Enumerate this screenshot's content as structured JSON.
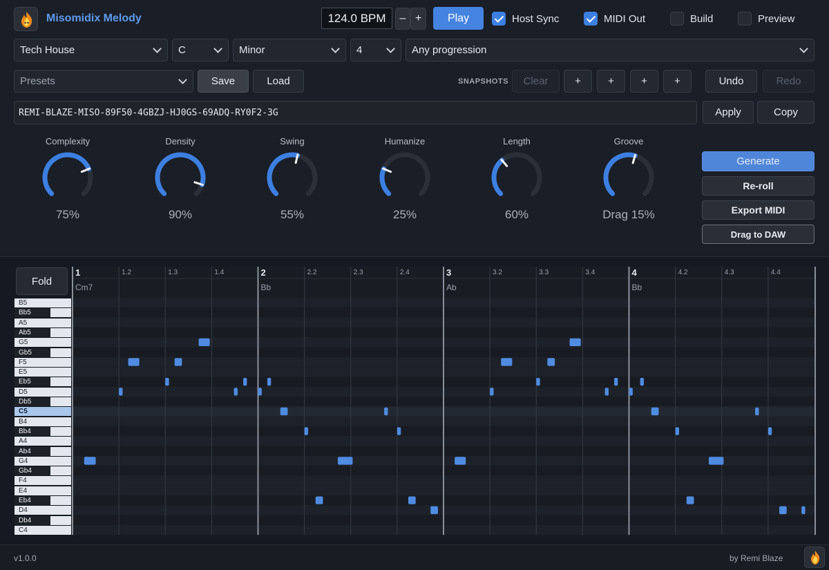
{
  "app": {
    "title": "Misomidix Melody",
    "version": "v1.0.0",
    "author": "by Remi Blaze"
  },
  "transport": {
    "bpm": "124.0 BPM",
    "minus": "–",
    "plus": "+",
    "play": "Play"
  },
  "toggles": [
    {
      "label": "Host Sync",
      "checked": true
    },
    {
      "label": "MIDI Out",
      "checked": true
    },
    {
      "label": "Build",
      "checked": false
    },
    {
      "label": "Preview",
      "checked": false
    }
  ],
  "selectors": {
    "style": "Tech House",
    "key": "C",
    "scale": "Minor",
    "bars": "4",
    "progression": "Any progression"
  },
  "presets": {
    "placeholder": "Presets",
    "save": "Save",
    "load": "Load"
  },
  "snapshots": {
    "label": "SNAPSHOTS",
    "clear": "Clear",
    "slots": [
      "+",
      "+",
      "+",
      "+"
    ]
  },
  "history": {
    "undo": "Undo",
    "redo": "Redo"
  },
  "seed": {
    "value": "REMI-BLAZE-MISO-89F50-4GBZJ-HJ0GS-69ADQ-RY0F2-3G",
    "apply": "Apply",
    "copy": "Copy"
  },
  "knobs": [
    {
      "label": "Complexity",
      "value": "75%",
      "level": 0.75
    },
    {
      "label": "Density",
      "value": "90%",
      "level": 0.9
    },
    {
      "label": "Swing",
      "value": "55%",
      "level": 0.55
    },
    {
      "label": "Humanize",
      "value": "25%",
      "level": 0.25
    },
    {
      "label": "Length",
      "value": "60%",
      "level": 0.35
    },
    {
      "label": "Groove",
      "value": "Drag 15%",
      "level": 0.56
    }
  ],
  "actions": {
    "generate": "Generate",
    "reroll": "Re-roll",
    "export": "Export MIDI",
    "drag": "Drag to DAW"
  },
  "roll": {
    "fold": "Fold",
    "ruler": [
      "1",
      "1.2",
      "1.3",
      "1.4",
      "2",
      "2.2",
      "2.3",
      "2.4",
      "3",
      "3.2",
      "3.3",
      "3.4",
      "4",
      "4.2",
      "4.3",
      "4.4"
    ],
    "chords": [
      "Cm7",
      "Bb",
      "Ab",
      "Bb"
    ],
    "keys": [
      "B5",
      "Bb5",
      "A5",
      "Ab5",
      "G5",
      "Gb5",
      "F5",
      "E5",
      "Eb5",
      "D5",
      "Db5",
      "C5",
      "B4",
      "Bb4",
      "A4",
      "Ab4",
      "G4",
      "Gb4",
      "F4",
      "E4",
      "Eb4",
      "D4",
      "Db4",
      "C4"
    ],
    "active_key": "C5",
    "notes": [
      {
        "pitch": "G4",
        "start": 1.0625,
        "dur": 0.0625
      },
      {
        "pitch": "D5",
        "start": 1.25,
        "dur": 0.02
      },
      {
        "pitch": "F5",
        "start": 1.3,
        "dur": 0.06
      },
      {
        "pitch": "Eb5",
        "start": 1.5,
        "dur": 0.02
      },
      {
        "pitch": "F5",
        "start": 1.55,
        "dur": 0.04
      },
      {
        "pitch": "G5",
        "start": 1.68,
        "dur": 0.06
      },
      {
        "pitch": "D5",
        "start": 1.87,
        "dur": 0.02
      },
      {
        "pitch": "Eb5",
        "start": 1.92,
        "dur": 0.02
      },
      {
        "pitch": "D5",
        "start": 2.0,
        "dur": 0.02
      },
      {
        "pitch": "Eb5",
        "start": 2.05,
        "dur": 0.02
      },
      {
        "pitch": "C5",
        "start": 2.12,
        "dur": 0.04
      },
      {
        "pitch": "Bb4",
        "start": 2.25,
        "dur": 0.02
      },
      {
        "pitch": "Eb4",
        "start": 2.31,
        "dur": 0.04
      },
      {
        "pitch": "G4",
        "start": 2.43,
        "dur": 0.08
      },
      {
        "pitch": "C5",
        "start": 2.68,
        "dur": 0.02
      },
      {
        "pitch": "Eb4",
        "start": 2.81,
        "dur": 0.04
      },
      {
        "pitch": "Bb4",
        "start": 2.75,
        "dur": 0.02
      },
      {
        "pitch": "D4",
        "start": 2.93,
        "dur": 0.04
      },
      {
        "pitch": "G4",
        "start": 3.06,
        "dur": 0.06
      },
      {
        "pitch": "D5",
        "start": 3.25,
        "dur": 0.02
      },
      {
        "pitch": "F5",
        "start": 3.31,
        "dur": 0.06
      },
      {
        "pitch": "Eb5",
        "start": 3.5,
        "dur": 0.02
      },
      {
        "pitch": "F5",
        "start": 3.56,
        "dur": 0.04
      },
      {
        "pitch": "G5",
        "start": 3.68,
        "dur": 0.06
      },
      {
        "pitch": "D5",
        "start": 3.87,
        "dur": 0.02
      },
      {
        "pitch": "Eb5",
        "start": 3.92,
        "dur": 0.02
      },
      {
        "pitch": "D5",
        "start": 4.0,
        "dur": 0.02
      },
      {
        "pitch": "Eb5",
        "start": 4.06,
        "dur": 0.02
      },
      {
        "pitch": "C5",
        "start": 4.12,
        "dur": 0.04
      },
      {
        "pitch": "Bb4",
        "start": 4.25,
        "dur": 0.02
      },
      {
        "pitch": "Eb4",
        "start": 4.31,
        "dur": 0.04
      },
      {
        "pitch": "G4",
        "start": 4.43,
        "dur": 0.08
      },
      {
        "pitch": "C5",
        "start": 4.68,
        "dur": 0.02
      },
      {
        "pitch": "Bb4",
        "start": 4.75,
        "dur": 0.02
      },
      {
        "pitch": "D4",
        "start": 4.81,
        "dur": 0.04
      },
      {
        "pitch": "D4",
        "start": 4.93,
        "dur": 0.02
      }
    ]
  },
  "colors": {
    "accent": "#3d7fe0",
    "note": "#4f8be0",
    "bg": "#151921"
  }
}
